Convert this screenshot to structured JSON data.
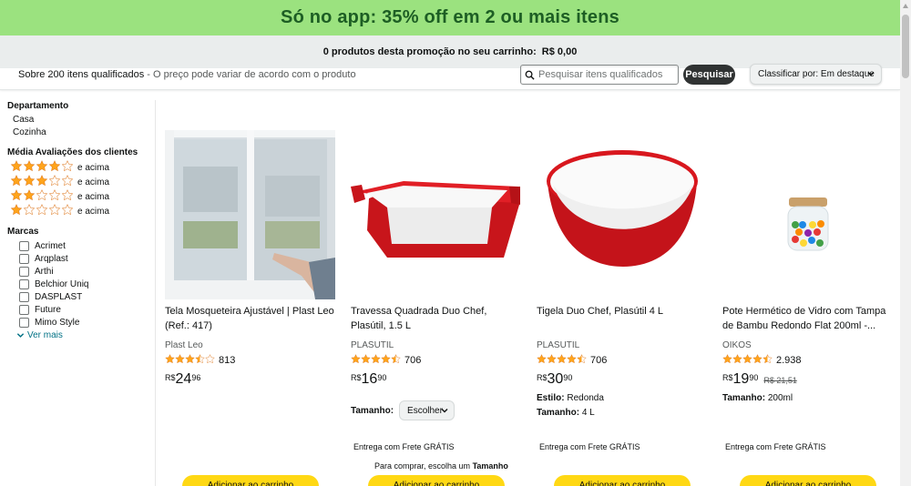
{
  "banner": {
    "text": "Só no app: 35% off em 2 ou mais itens"
  },
  "cart_bar": {
    "text": "0 produtos desta promoção no seu carrinho:",
    "amount": "R$ 0,00"
  },
  "toolbar": {
    "results": "Sobre 200 itens qualificados",
    "results_note": "- O preço pode variar de acordo com o produto",
    "search_placeholder": "Pesquisar itens qualificados",
    "search_button": "Pesquisar",
    "sort_label": "Classificar por:",
    "sort_value": "Em destaque"
  },
  "sidebar": {
    "department_title": "Departamento",
    "departments": [
      "Casa",
      "Cozinha"
    ],
    "rating_title": "Média Avaliações dos clientes",
    "ratings": [
      {
        "stars": 4,
        "label": "e acima"
      },
      {
        "stars": 3,
        "label": "e acima"
      },
      {
        "stars": 2,
        "label": "e acima"
      },
      {
        "stars": 1,
        "label": "e acima"
      }
    ],
    "brands_title": "Marcas",
    "brands": [
      "Acrimet",
      "Arqplast",
      "Arthi",
      "Belchior Uniq",
      "DASPLAST",
      "Future",
      "Mimo Style"
    ],
    "see_more": "Ver mais"
  },
  "products": [
    {
      "title": "Tela Mosqueteira Ajustável | Plast Leo (Ref.: 417)",
      "brand": "Plast Leo",
      "rating": 3.5,
      "reviews": "813",
      "currency": "R$",
      "price_int": "24",
      "price_dec": "96",
      "shipping": "",
      "cart_button": "Adicionar ao carrinho"
    },
    {
      "title": "Travessa Quadrada Duo Chef, Plasútil, 1.5 L",
      "brand": "PLASUTIL",
      "rating": 4.5,
      "reviews": "706",
      "currency": "R$",
      "price_int": "16",
      "price_dec": "90",
      "size_label": "Tamanho:",
      "size_select": "Escolher",
      "shipping": "Entrega com Frete GRÁTIS",
      "buy_note": "Para comprar, escolha um",
      "buy_note_bold": "Tamanho",
      "cart_button": "Adicionar ao carrinho"
    },
    {
      "title": "Tigela Duo Chef, Plasútil 4 L",
      "brand": "PLASUTIL",
      "rating": 4.5,
      "reviews": "706",
      "currency": "R$",
      "price_int": "30",
      "price_dec": "90",
      "style_label": "Estilo:",
      "style_value": "Redonda",
      "size_label": "Tamanho:",
      "size_value": "4 L",
      "shipping": "Entrega com Frete GRÁTIS",
      "cart_button": "Adicionar ao carrinho"
    },
    {
      "title": "Pote Hermético de Vidro com Tampa de Bambu Redondo Flat 200ml -...",
      "brand": "OIKOS",
      "rating": 4.5,
      "reviews": "2.938",
      "currency": "R$",
      "price_int": "19",
      "price_dec": "90",
      "old_price": "R$ 21,51",
      "size_label": "Tamanho:",
      "size_value": "200ml",
      "shipping": "Entrega com Frete GRÁTIS",
      "cart_button": "Adicionar ao carrinho"
    }
  ],
  "colors": {
    "banner": "#9be27f",
    "star": "#ffa41c",
    "button": "#ffd814",
    "link": "#007185"
  }
}
